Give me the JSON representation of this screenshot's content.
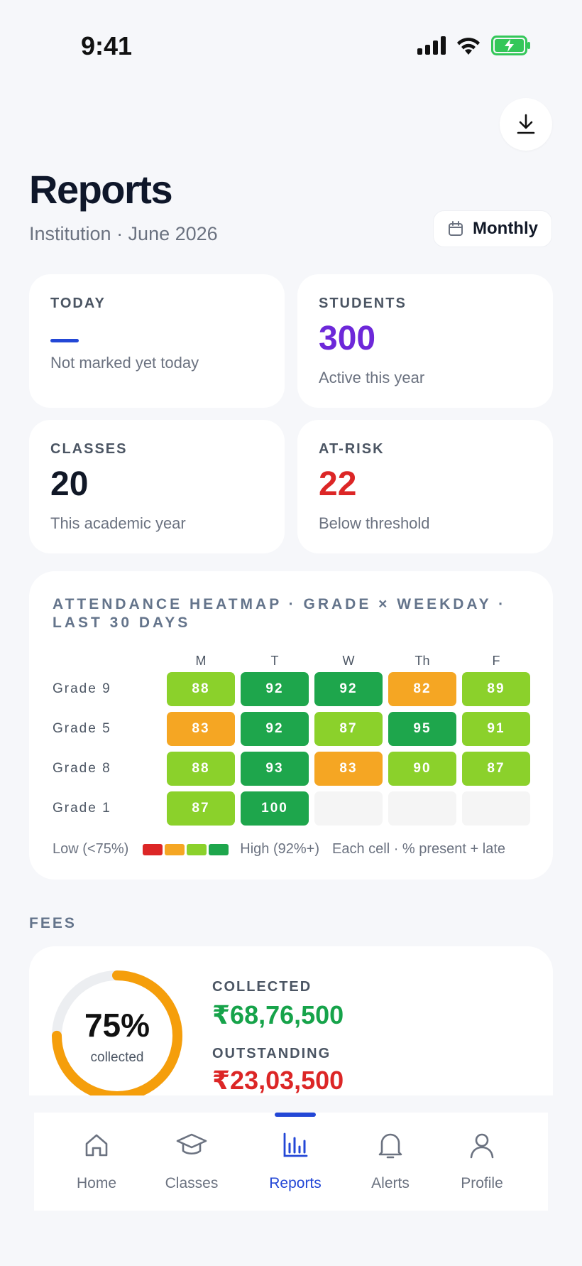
{
  "status": {
    "time": "9:41"
  },
  "header": {
    "title": "Reports",
    "subtitle": "Institution · June 2026",
    "period_button": "Monthly"
  },
  "stats": [
    {
      "label": "TODAY",
      "value": "—",
      "desc": "Not marked yet today",
      "color": "#2347d6"
    },
    {
      "label": "STUDENTS",
      "value": "300",
      "desc": "Active this year",
      "color": "#6d28d9"
    },
    {
      "label": "CLASSES",
      "value": "20",
      "desc": "This academic year",
      "color": "#111827"
    },
    {
      "label": "AT-RISK",
      "value": "22",
      "desc": "Below threshold",
      "color": "#dc2626"
    }
  ],
  "heatmap": {
    "title": "ATTENDANCE HEATMAP · GRADE × WEEKDAY · LAST 30 DAYS",
    "columns": [
      "M",
      "T",
      "W",
      "Th",
      "F"
    ],
    "rows": [
      {
        "label": "Grade 9",
        "values": [
          "88",
          "92",
          "92",
          "82",
          "89"
        ]
      },
      {
        "label": "Grade 5",
        "values": [
          "83",
          "92",
          "87",
          "95",
          "91"
        ]
      },
      {
        "label": "Grade 8",
        "values": [
          "88",
          "93",
          "83",
          "90",
          "87"
        ]
      },
      {
        "label": "Grade 1",
        "values": [
          "87",
          "100",
          "",
          "",
          ""
        ]
      }
    ],
    "legend_low": "Low (<75%)",
    "legend_high": "High (92%+)",
    "legend_note": "Each cell · % present + late",
    "colors": {
      "red": "#dc2626",
      "orange": "#f5a623",
      "lightgreen": "#8bd12b",
      "green": "#1ea64c",
      "empty": "#f5f5f5"
    }
  },
  "fees": {
    "section_label": "FEES",
    "percent": "75%",
    "percent_value": 75,
    "percent_sub": "collected",
    "collected_label": "COLLECTED",
    "collected_value": "₹68,76,500",
    "outstanding_label": "OUTSTANDING",
    "outstanding_value": "₹23,03,500"
  },
  "nav": {
    "items": [
      {
        "label": "Home",
        "icon": "home-icon"
      },
      {
        "label": "Classes",
        "icon": "graduation-cap-icon"
      },
      {
        "label": "Reports",
        "icon": "bar-chart-icon",
        "active": true
      },
      {
        "label": "Alerts",
        "icon": "bell-icon"
      },
      {
        "label": "Profile",
        "icon": "user-icon"
      }
    ]
  }
}
